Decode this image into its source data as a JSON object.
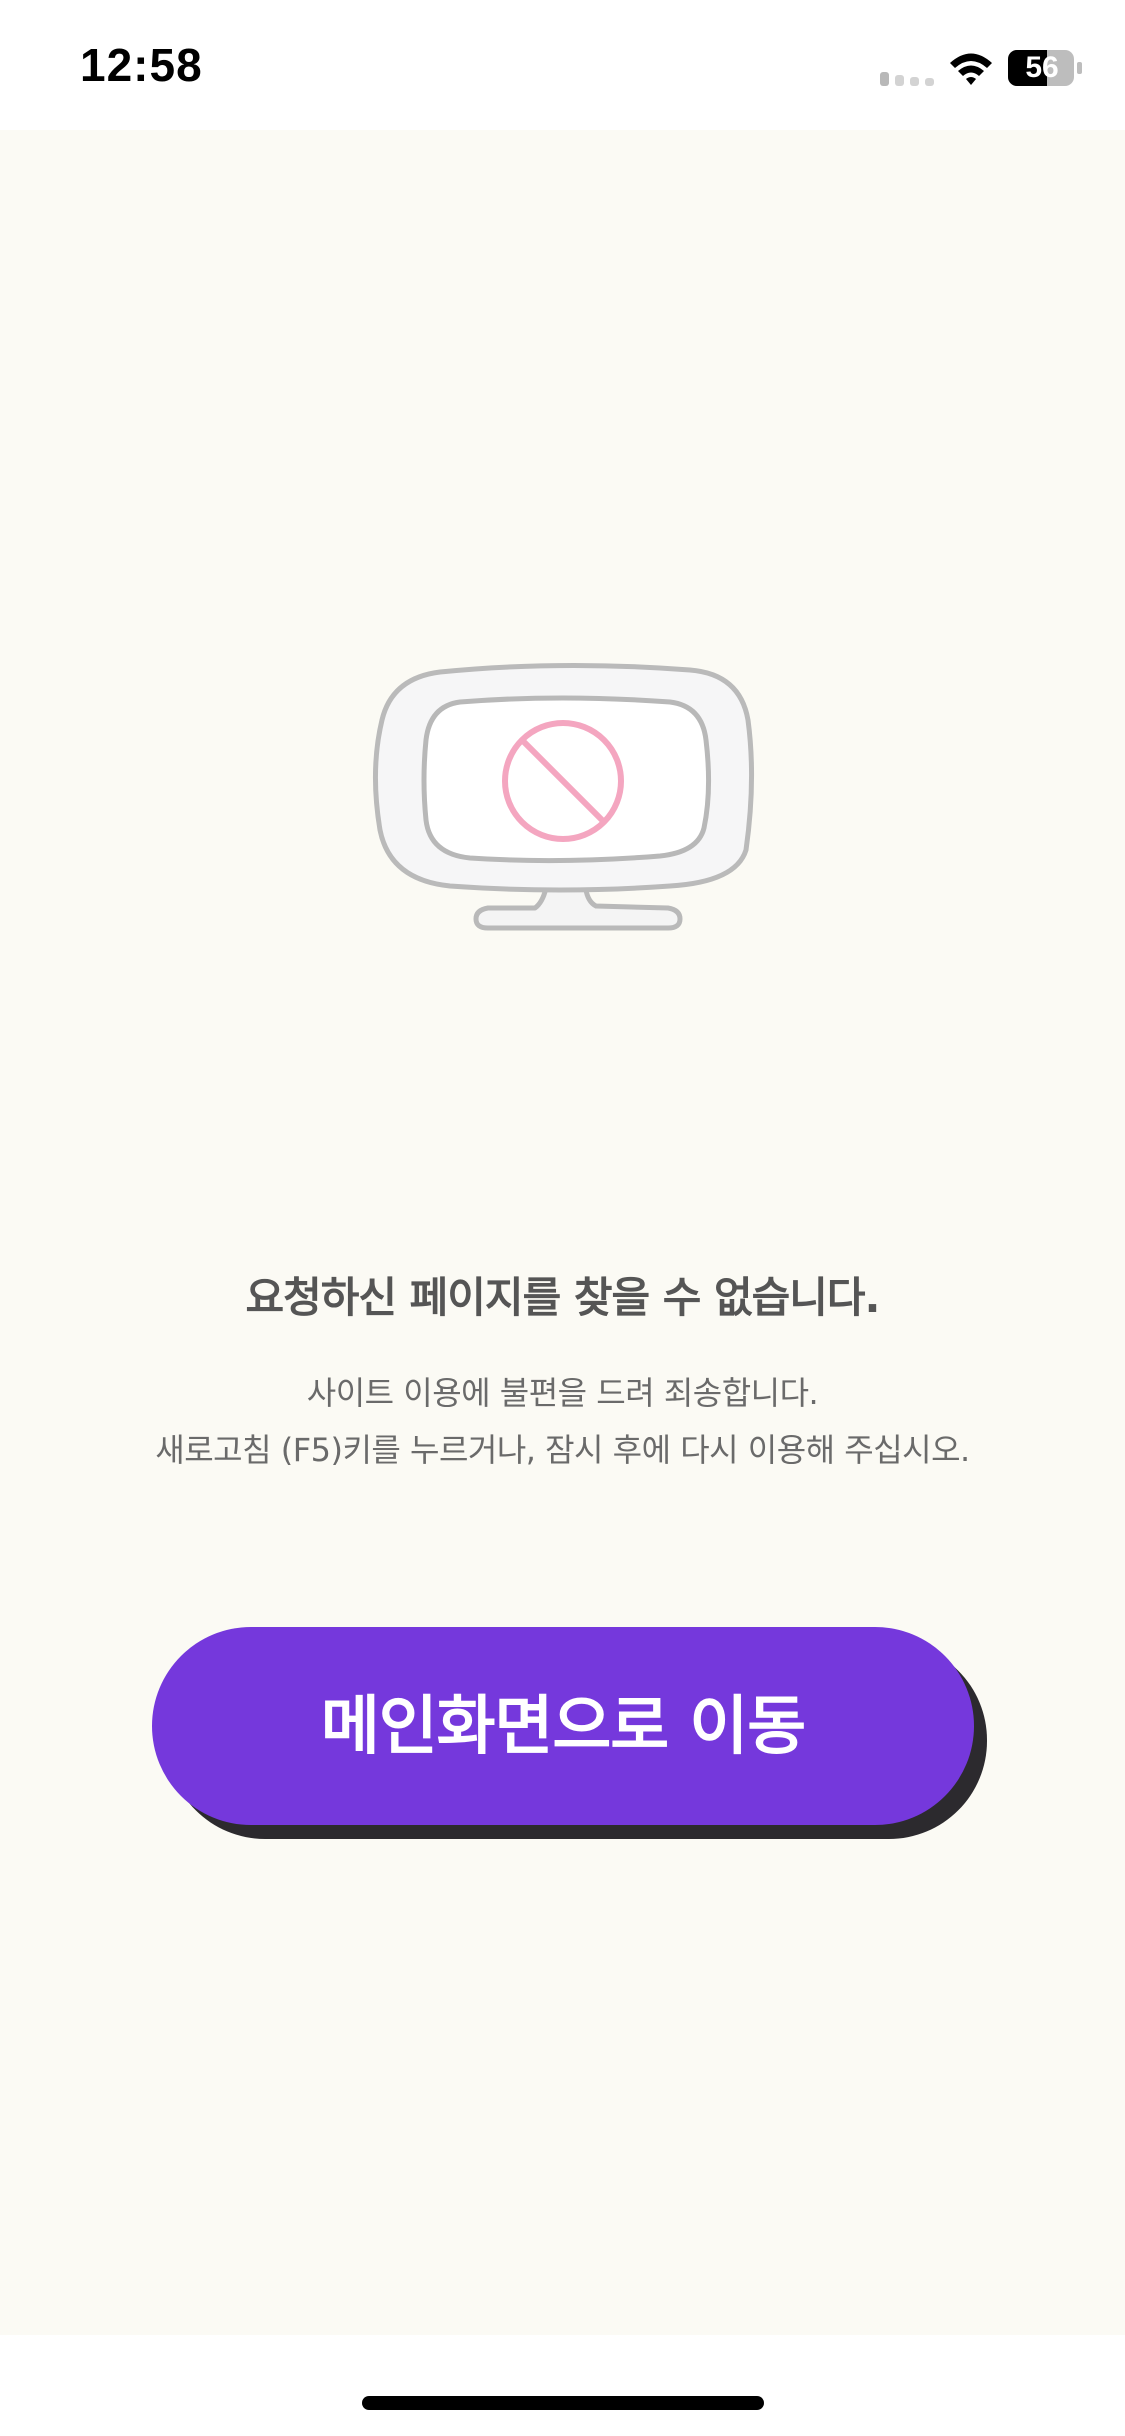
{
  "status_bar": {
    "time": "12:58",
    "battery_level": "56"
  },
  "error": {
    "title": "요청하신 페이지를 찾을 수 없습니다.",
    "message_line_1": "사이트 이용에 불편을 드려 죄송합니다.",
    "message_line_2": "새로고침 (F5)키를 누르거나, 잠시 후에 다시 이용해 주십시오."
  },
  "actions": {
    "main_button_label": "메인화면으로 이동"
  },
  "icons": {
    "status": [
      "signal-icon",
      "wifi-icon",
      "battery-icon"
    ],
    "illustration": "monitor-prohibited-icon"
  },
  "colors": {
    "background": "#fbfaf4",
    "button": "#7538dc",
    "button_shadow": "#2c2a2e",
    "prohibited_sign": "#f4a6c0"
  }
}
